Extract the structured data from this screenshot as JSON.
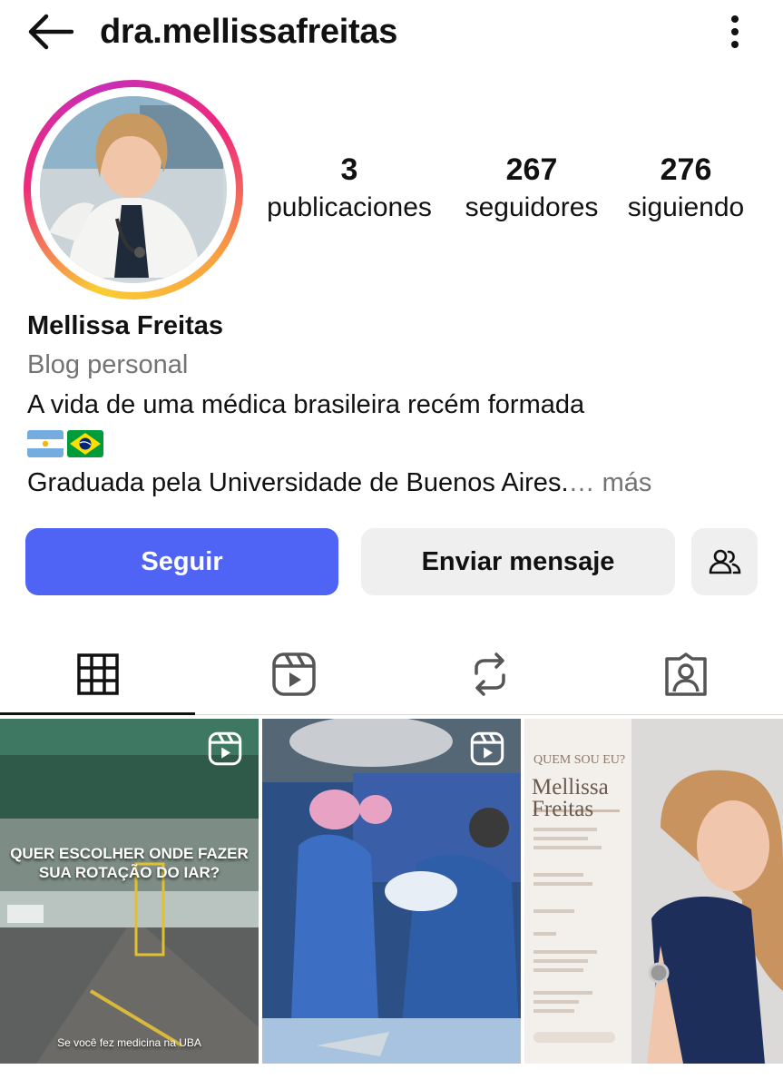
{
  "header": {
    "username": "dra.mellissafreitas"
  },
  "stats": {
    "posts": {
      "value": "3",
      "label": "publicaciones"
    },
    "followers": {
      "value": "267",
      "label": "seguidores"
    },
    "following": {
      "value": "276",
      "label": "siguiendo"
    }
  },
  "bio": {
    "name": "Mellissa Freitas",
    "category": "Blog personal",
    "line1": "A vida de uma médica brasileira recém formada",
    "line3": "Graduada pela Universidade de Buenos Aires.",
    "ellipsis": "…",
    "more": "más"
  },
  "actions": {
    "follow": "Seguir",
    "message": "Enviar mensaje"
  },
  "posts": [
    {
      "type": "reel",
      "overlay_line1": "QUER ESCOLHER ONDE FAZER",
      "overlay_line2": "SUA ROTAÇÃO DO IAR?",
      "caption": "Se você fez medicina na UBA"
    },
    {
      "type": "reel"
    },
    {
      "type": "post",
      "kicker": "QUEM SOU EU?",
      "name_line1": "Mellissa",
      "name_line2": "Freitas"
    }
  ],
  "colors": {
    "follow_button": "#4f63f5",
    "secondary_button": "#efeff0",
    "muted_text": "#737373"
  }
}
